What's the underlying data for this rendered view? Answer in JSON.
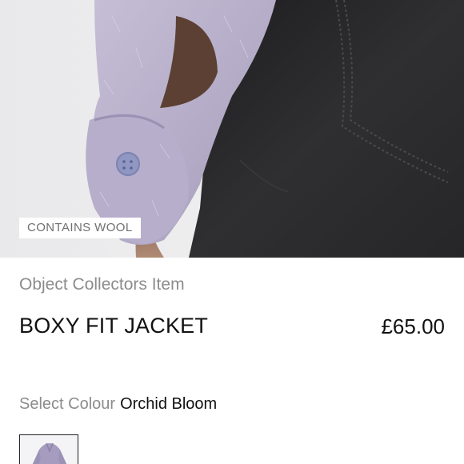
{
  "product": {
    "badge": "CONTAINS WOOL",
    "brand": "Object Collectors Item",
    "name": "BOXY FIT JACKET",
    "price": "£65.00"
  },
  "colour": {
    "label": "Select Colour",
    "selected": "Orchid Bloom"
  },
  "colors": {
    "lilac": "#b8afc9",
    "denim": "#2b2b2d",
    "text_muted": "#8c8c8c"
  }
}
